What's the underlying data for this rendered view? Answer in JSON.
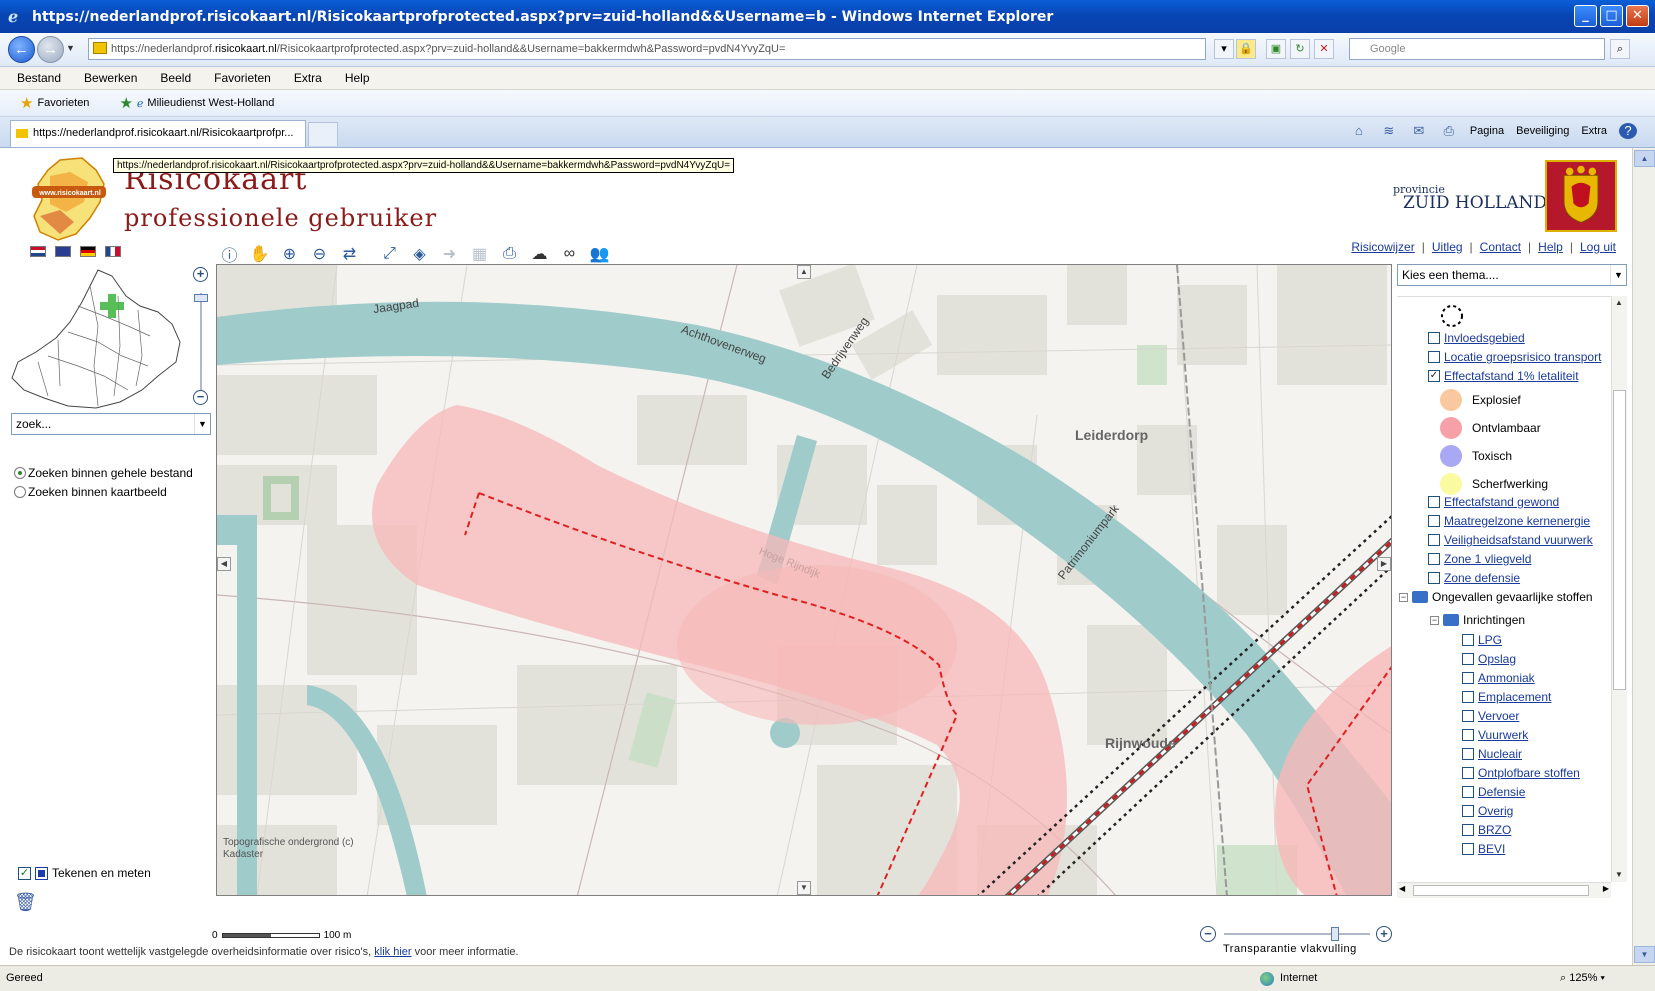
{
  "window": {
    "title": "https://nederlandprof.risicokaart.nl/Risicokaartprofprotected.aspx?prv=zuid-holland&&Username=b - Windows Internet Explorer"
  },
  "address": {
    "url_prefix": "https://nederlandprof.",
    "url_domain": "risicokaart.nl",
    "url_rest": "/Risicokaartprofprotected.aspx?prv=zuid-holland&&Username=bakkermdwh&Password=pvdN4YvyZqU=",
    "search_placeholder": "Google"
  },
  "menu": [
    "Bestand",
    "Bewerken",
    "Beeld",
    "Favorieten",
    "Extra",
    "Help"
  ],
  "favorites": {
    "label": "Favorieten",
    "link": "Milieudienst West-Holland"
  },
  "tab": {
    "label": "https://nederlandprof.risicokaart.nl/Risicokaartprofpr..."
  },
  "commandbar": {
    "page": "Pagina",
    "security": "Beveiliging",
    "extra": "Extra"
  },
  "tooltip": "https://nederlandprof.risicokaart.nl/Risicokaartprofprotected.aspx?prv=zuid-holland&&Username=bakkermdwh&Password=pvdN4YvyZqU=",
  "header": {
    "logo_small": "www.risicokaart.nl",
    "title_line1": "Risicokaart",
    "title_line2": "professionele gebruiker",
    "province_line1": "provincie",
    "province_line2": "ZUID HOLLAND"
  },
  "top_links": [
    "Risicowijzer",
    "Uitleg",
    "Contact",
    "Help",
    "Log uit"
  ],
  "left": {
    "search_placeholder": "zoek...",
    "radio_1": "Zoeken binnen gehele bestand",
    "radio_2": "Zoeken binnen kaartbeeld",
    "draw_measure": "Tekenen en meten"
  },
  "map": {
    "labels": {
      "jaagpad": "Jaagpad",
      "achthovenerweg": "Achthovenerweg",
      "bedrijvenweg": "Bedrijvenweg",
      "leiderdorp": "Leiderdorp",
      "patrimoniumpark": "Patrimoniumpark",
      "rijnwoude": "Rijnwoude",
      "hoge_rijndijk": "Hoge Rijndijk"
    },
    "copyright_line1": "Topografische ondergrond (c)",
    "copyright_line2": "Kadaster",
    "scale_start": "0",
    "scale_end": "100 m",
    "transparency_label": "Transparantie vlakvulling",
    "transparency_level": 0.76
  },
  "footer": {
    "text_before": "De risicokaart toont wettelijk vastgelegde overheidsinformatie over risico's,",
    "link": "klik hier",
    "text_after": "voor meer informatie."
  },
  "theme": {
    "select_label": "Kies een thema....",
    "items": [
      {
        "label": "Invloedsgebied",
        "checked": false
      },
      {
        "label": "Locatie groepsrisico transport",
        "checked": false
      },
      {
        "label": "Effectafstand 1% letaliteit",
        "checked": true
      }
    ],
    "legend": [
      {
        "label": "Explosief",
        "color": "#f9c8a0"
      },
      {
        "label": "Ontvlambaar",
        "color": "#f8a0a8"
      },
      {
        "label": "Toxisch",
        "color": "#a8a8f4"
      },
      {
        "label": "Scherfwerking",
        "color": "#fafaa0"
      }
    ],
    "items_after": [
      {
        "label": "Effectafstand gewond"
      },
      {
        "label": "Maatregelzone kernenergie"
      },
      {
        "label": "Veiligheidsafstand vuurwerk"
      },
      {
        "label": "Zone 1 vliegveld"
      },
      {
        "label": "Zone defensie"
      }
    ],
    "group": "Ongevallen gevaarlijke stoffen",
    "subgroup": "Inrichtingen",
    "sub_items": [
      "LPG",
      "Opslag",
      "Ammoniak",
      "Emplacement",
      "Vervoer",
      "Vuurwerk",
      "Nucleair",
      "Ontplofbare stoffen",
      "Defensie",
      "Overig",
      "BRZO",
      "BEVI"
    ]
  },
  "status": {
    "left": "Gereed",
    "zone": "Internet",
    "zoom": "125%"
  },
  "colors": {
    "water": "#9fcccb",
    "risk_zone": "#f7b8b8",
    "risk_dash": "#e02020",
    "brand_red": "#8b1a1a",
    "link_blue": "#1a3a9c"
  }
}
